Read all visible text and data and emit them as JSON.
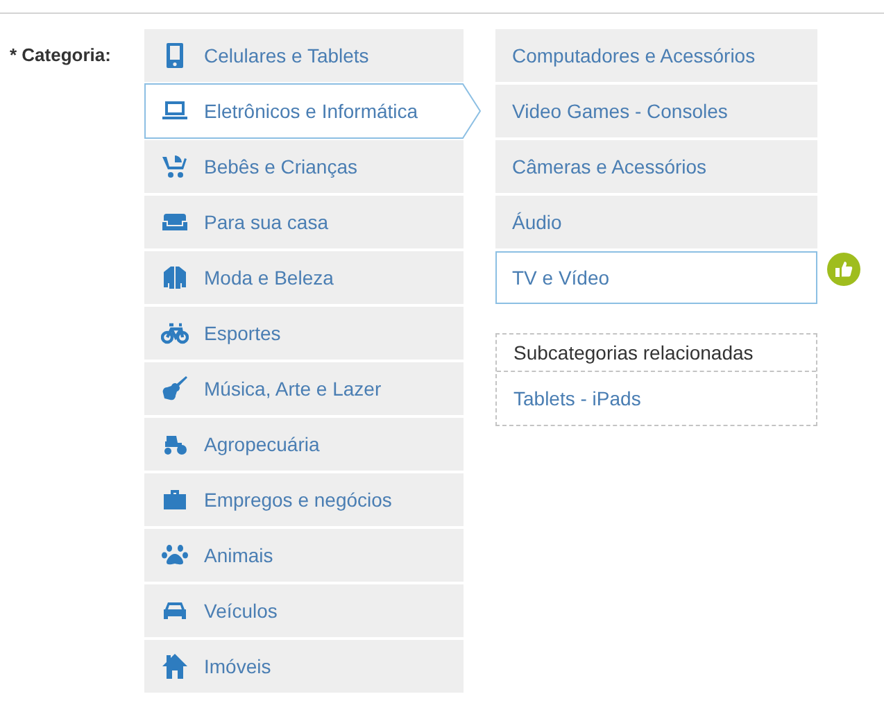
{
  "field_label": "* Categoria:",
  "categories": [
    {
      "label": "Celulares e Tablets",
      "selected": false
    },
    {
      "label": "Eletrônicos e Informática",
      "selected": true
    },
    {
      "label": "Bebês e Crianças",
      "selected": false
    },
    {
      "label": "Para sua casa",
      "selected": false
    },
    {
      "label": "Moda e Beleza",
      "selected": false
    },
    {
      "label": "Esportes",
      "selected": false
    },
    {
      "label": "Música, Arte e Lazer",
      "selected": false
    },
    {
      "label": "Agropecuária",
      "selected": false
    },
    {
      "label": "Empregos e negócios",
      "selected": false
    },
    {
      "label": "Animais",
      "selected": false
    },
    {
      "label": "Veículos",
      "selected": false
    },
    {
      "label": "Imóveis",
      "selected": false
    }
  ],
  "subcategories": [
    {
      "label": "Computadores e Acessórios",
      "selected": false
    },
    {
      "label": "Video Games - Consoles",
      "selected": false
    },
    {
      "label": "Câmeras e Acessórios",
      "selected": false
    },
    {
      "label": "Áudio",
      "selected": false
    },
    {
      "label": "TV e Vídeo",
      "selected": true
    }
  ],
  "related": {
    "title": "Subcategorias relacionadas",
    "items": [
      {
        "label": "Tablets - iPads",
        "selected": false
      }
    ]
  }
}
